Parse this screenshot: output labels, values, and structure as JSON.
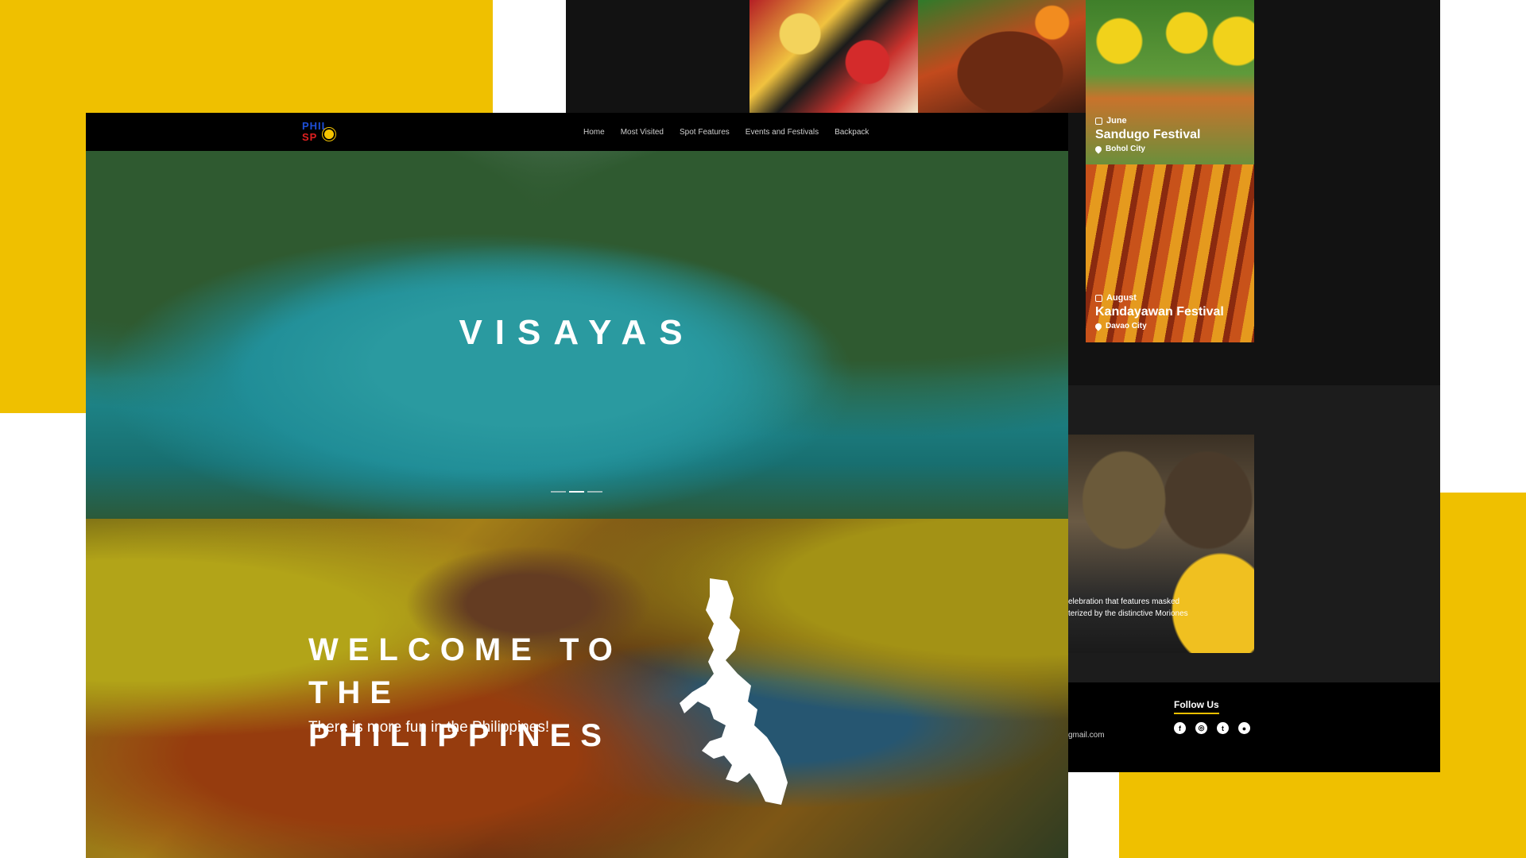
{
  "nav": {
    "logo_line1": "PHIL",
    "logo_line2": "SP",
    "links": [
      "Home",
      "Most Visited",
      "Spot Features",
      "Events and Festivals",
      "Backpack"
    ]
  },
  "hero": {
    "title": "VISAYAS",
    "slides_total": 3,
    "active_slide": 2
  },
  "welcome": {
    "title": "WELCOME TO THE PHILIPPINES",
    "subtitle": "There is more fun in the Philippines!"
  },
  "festivals": [
    {
      "month": "June",
      "name": "Sandugo Festival",
      "location": "Bohol City"
    },
    {
      "month": "August",
      "name": "Kandayawan Festival",
      "location": "Davao City"
    }
  ],
  "moriones": {
    "line1": "elebration that features masked",
    "line2": "terized by the distinctive Moriones"
  },
  "footer": {
    "follow_title": "Follow Us",
    "email_fragment": "gmail.com",
    "social_icons": [
      "facebook-icon",
      "instagram-icon",
      "twitter-icon",
      "github-icon"
    ]
  },
  "colors": {
    "accent_yellow": "#efc000",
    "nav_bg": "#000000"
  }
}
